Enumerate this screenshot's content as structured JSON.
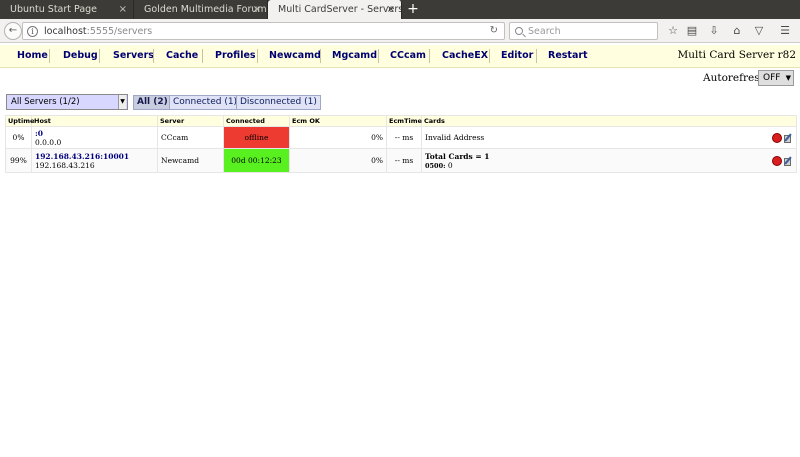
{
  "browser": {
    "tabs": [
      {
        "title": "Ubuntu Start Page",
        "close": "×"
      },
      {
        "title": "Golden Multimedia Forum",
        "close": "×"
      },
      {
        "title": "Multi CardServer - Servers",
        "close": "×"
      }
    ],
    "new_tab": "+",
    "url": {
      "host": "localhost",
      "rest": ":5555/servers"
    },
    "search_placeholder": "Search"
  },
  "nav": {
    "items": [
      "Home",
      "Debug",
      "Servers",
      "Cache",
      "Profiles",
      "Newcamd",
      "Mgcamd",
      "CCcam",
      "CacheEX",
      "Editor",
      "Restart"
    ],
    "brand": "Multi Card Server r82"
  },
  "autorefresh": {
    "label": "Autorefresh",
    "value": "OFF"
  },
  "filters": {
    "select": "All Servers (1/2)",
    "buttons": [
      "All (2)",
      "Connected (1)",
      "Disconnected (1)"
    ]
  },
  "table": {
    "headers": [
      "Uptime",
      "Host",
      "Server",
      "Connected",
      "Ecm OK",
      "EcmTime",
      "Cards"
    ],
    "rows": [
      {
        "uptime": "0%",
        "host": ":0",
        "ip": "0.0.0.0",
        "server": "CCcam",
        "connected": "offline",
        "ecm_ok": "0%",
        "ecm_time": "-- ms",
        "cards": "Invalid Address",
        "cards_sub": ""
      },
      {
        "uptime": "99%",
        "host": "192.168.43.216:10001",
        "ip": "192.168.43.216",
        "server": "Newcamd",
        "connected": "00d 00:12:23",
        "ecm_ok": "0%",
        "ecm_time": "-- ms",
        "cards": "Total Cards = 1",
        "cards_sub_bold": "0500:",
        "cards_sub": "0"
      }
    ]
  },
  "colors": {
    "offline": "#ee3b32",
    "online": "#59f020",
    "nav_bg": "#ffffe0",
    "nav_text": "#000070"
  }
}
